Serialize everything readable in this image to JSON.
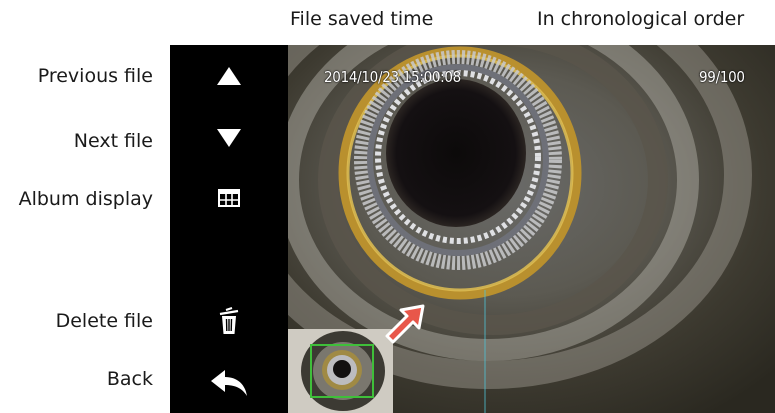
{
  "annotations": {
    "file_saved_time": "File saved time",
    "chronological_order": "In chronological order",
    "previous_file": "Previous file",
    "next_file": "Next file",
    "album_display": "Album display",
    "delete_file": "Delete file",
    "back": "Back"
  },
  "sidebar": {
    "buttons": [
      {
        "icon": "triangle-up-icon"
      },
      {
        "icon": "triangle-down-icon"
      },
      {
        "icon": "grid-icon"
      },
      {
        "icon": "blank"
      },
      {
        "icon": "trash-icon"
      },
      {
        "icon": "back-arrow-icon"
      }
    ]
  },
  "viewer": {
    "timestamp": "2014/10/23 15:00:08",
    "file_counter": "99/100"
  },
  "colors": {
    "sidebar_bg": "#000000",
    "thumbnail_frame": "#3fbf3a",
    "pointer_arrow": "#e8574a"
  }
}
